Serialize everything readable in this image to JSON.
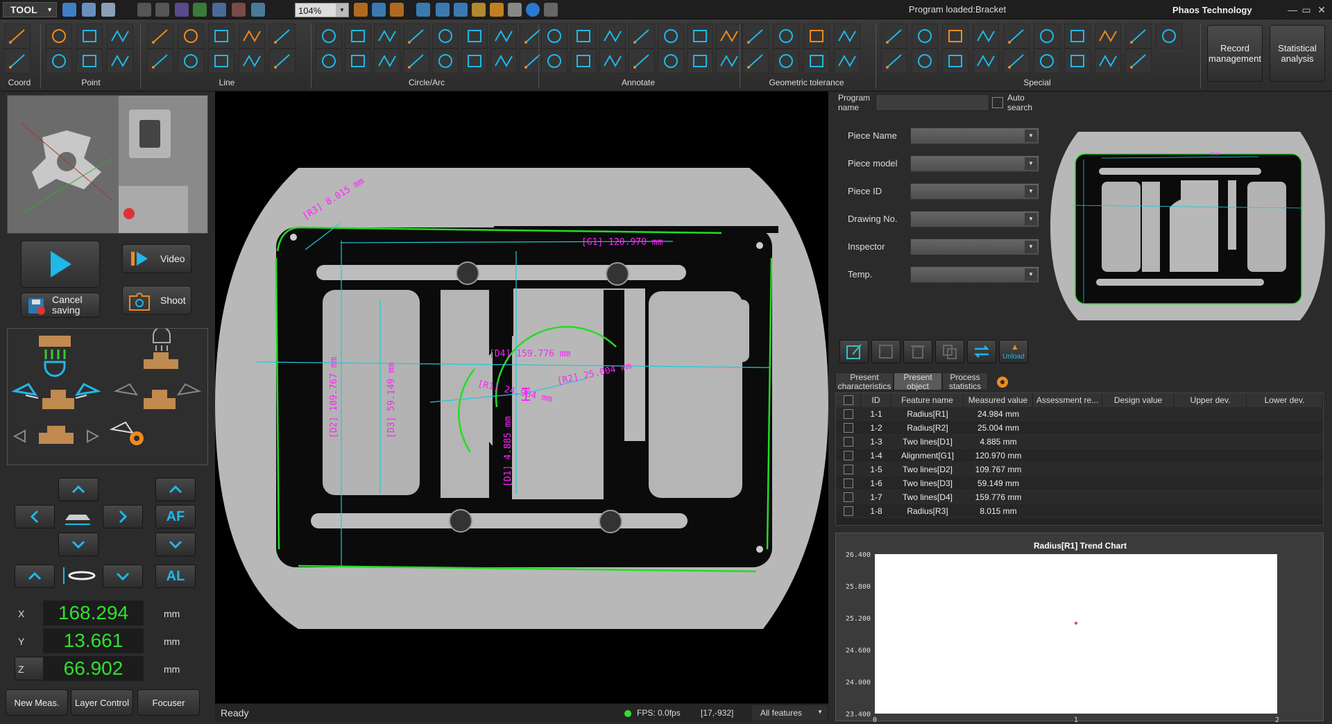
{
  "titlebar": {
    "tool_menu": "TOOL",
    "zoom": "104%",
    "title": "Program  loaded:Bracket",
    "company": "Phaos Technology"
  },
  "ribbon": {
    "groups": [
      "Coord",
      "Point",
      "Line",
      "Circle/Arc",
      "Annotate",
      "Geometric tolerance",
      "Special"
    ],
    "record_management": "Record management",
    "statistical_analysis": "Statistical analysis"
  },
  "left": {
    "run_button": "run",
    "video": "Video",
    "cancel_saving": "Cancel saving",
    "shoot": "Shoot",
    "af": "AF",
    "al": "AL",
    "coords": [
      {
        "axis": "X",
        "value": "168.294",
        "unit": "mm"
      },
      {
        "axis": "Y",
        "value": "13.661",
        "unit": "mm"
      },
      {
        "axis": "Z",
        "value": "66.902",
        "unit": "mm"
      }
    ],
    "new_meas": "New Meas.",
    "layer_control": "Layer Control",
    "focuser": "Focuser"
  },
  "viewport": {
    "labels": {
      "r3": "[R3] 8.015 mm",
      "g1": "[G1] 120.970 mm",
      "d4": "[D4] 159.776 mm",
      "r1": "[R1] 24.984 mm",
      "r2": "[R2] 25.004 mm",
      "d2": "[D2] 109.767 mm",
      "d3": "[D3] 59.149 mm",
      "d1": "[D1] 4.885 mm"
    }
  },
  "status": {
    "ready": "Ready",
    "fps": "FPS: 0.0fps",
    "pos": "[17,-932]",
    "filter": "All features"
  },
  "form": {
    "program_name_label": "Program name",
    "auto_search": "Auto search",
    "fields": [
      "Piece Name",
      "Piece model",
      "Piece ID",
      "Drawing No.",
      "Inspector",
      "Temp."
    ],
    "unload": "Unload"
  },
  "tabs": [
    "Present characteristics",
    "Present object",
    "Process statistics"
  ],
  "table": {
    "headers": [
      "ID",
      "Feature name",
      "Measured value",
      "Assessment re...",
      "Design value",
      "Upper dev.",
      "Lower dev."
    ],
    "rows": [
      {
        "id": "1-1",
        "name": "Radius[R1]",
        "value": "24.984 mm"
      },
      {
        "id": "1-2",
        "name": "Radius[R2]",
        "value": "25.004 mm"
      },
      {
        "id": "1-3",
        "name": "Two lines[D1]",
        "value": "4.885 mm"
      },
      {
        "id": "1-4",
        "name": "Alignment[G1]",
        "value": "120.970 mm"
      },
      {
        "id": "1-5",
        "name": "Two lines[D2]",
        "value": "109.767 mm"
      },
      {
        "id": "1-6",
        "name": "Two lines[D3]",
        "value": "59.149 mm"
      },
      {
        "id": "1-7",
        "name": "Two lines[D4]",
        "value": "159.776 mm"
      },
      {
        "id": "1-8",
        "name": "Radius[R3]",
        "value": "8.015 mm"
      }
    ]
  },
  "chart_data": {
    "type": "scatter",
    "title": "Radius[R1] Trend Chart",
    "x": [
      1
    ],
    "y": [
      25.1
    ],
    "xlim": [
      0,
      2
    ],
    "ylim": [
      23.4,
      26.4
    ],
    "yticks": [
      "26.400",
      "25.800",
      "25.200",
      "24.600",
      "24.000",
      "23.400"
    ],
    "xticks": [
      "0",
      "1",
      "2"
    ],
    "point_color": "#e04040"
  }
}
